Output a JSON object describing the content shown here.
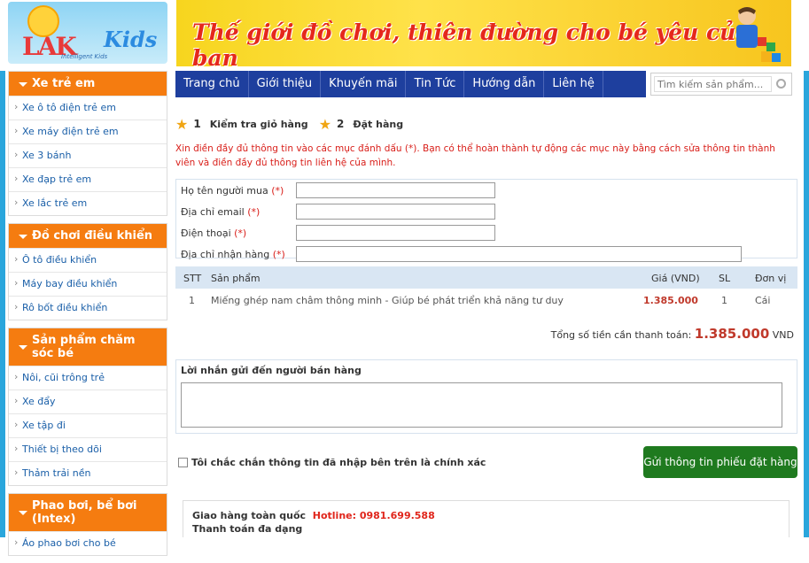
{
  "header": {
    "logo_text": "LAK",
    "logo_kids": "Kids",
    "logo_tagline": "Intelligent Kids",
    "banner_slogan": "Thế giới đồ chơi, thiên đường cho bé yêu của bạn"
  },
  "nav": {
    "items": [
      "Trang chủ",
      "Giới thiệu",
      "Khuyến mãi",
      "Tin Tức",
      "Hướng dẫn",
      "Liên hệ"
    ],
    "search_placeholder": "Tìm kiếm sản phẩm..."
  },
  "sidebar": {
    "categories": [
      {
        "title": "Xe trẻ em",
        "items": [
          "Xe ô tô điện trẻ em",
          "Xe máy điện trẻ em",
          "Xe 3 bánh",
          "Xe đạp trẻ em",
          "Xe lắc trẻ em"
        ]
      },
      {
        "title": "Đồ chơi điều khiển",
        "items": [
          "Ô tô điều khiển",
          "Máy bay điều khiển",
          "Rô bốt điều khiển"
        ]
      },
      {
        "title": "Sản phẩm chăm sóc bé",
        "items": [
          "Nôi, cũi trông trẻ",
          "Xe đẩy",
          "Xe tập đi",
          "Thiết bị theo dõi",
          "Thảm trải nền"
        ]
      },
      {
        "title": "Phao bơi, bể bơi (Intex)",
        "items": [
          "Áo phao bơi cho bé"
        ]
      }
    ]
  },
  "steps": [
    {
      "num": "1",
      "label": "Kiểm tra giỏ hàng"
    },
    {
      "num": "2",
      "label": "Đặt hàng"
    }
  ],
  "note": "Xin điền đầy đủ thông tin vào các mục đánh dấu (*). Bạn có thể hoàn thành tự động các mục này bằng cách sửa thông tin thành viên và điền đầy đủ thông tin liên hệ của mình.",
  "form": {
    "required_mark": "(*)",
    "fields": [
      "Họ tên người mua",
      "Địa chỉ email",
      "Điện thoại",
      "Địa chỉ nhận hàng"
    ]
  },
  "table": {
    "headers": [
      "STT",
      "Sản phẩm",
      "Giá (VND)",
      "SL",
      "Đơn vị"
    ],
    "rows": [
      {
        "stt": "1",
        "product": "Miếng ghép nam châm thông minh - Giúp bé phát triển khả năng tư duy",
        "price": "1.385.000",
        "qty": "1",
        "unit": "Cái"
      }
    ]
  },
  "total": {
    "label": "Tổng số tiền cần thanh toán:",
    "amount": "1.385.000",
    "currency": "VND"
  },
  "message": {
    "label": "Lời nhắn gửi đến người bán hàng"
  },
  "confirm_label": "Tôi chắc chắn thông tin đã nhập bên trên là chính xác",
  "submit_label": "Gửi thông tin phiếu đặt hàng",
  "delivery": {
    "line1": "Giao hàng toàn quốc",
    "hotline": "Hotline: 0981.699.588",
    "line2": "Thanh toán đa dạng"
  },
  "colors": {
    "accent": "#f57c10",
    "nav": "#1e3f9e",
    "submit": "#1f7a1f",
    "price": "#c0392b"
  }
}
